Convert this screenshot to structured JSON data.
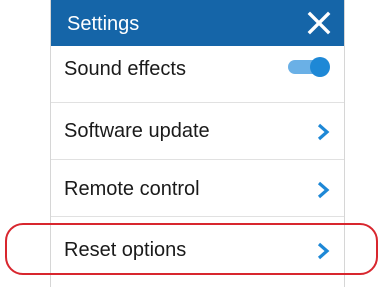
{
  "header": {
    "title": "Settings",
    "close_icon": "close-icon",
    "background_color": "#1565a8"
  },
  "settings": {
    "sound_effects": {
      "label": "Sound effects",
      "toggle_on": true,
      "accent_color": "#1e88d6"
    },
    "software_update": {
      "label": "Software update",
      "icon": "chevron-right-icon"
    },
    "remote_control": {
      "label": "Remote control",
      "icon": "chevron-right-icon"
    },
    "reset_options": {
      "label": "Reset options",
      "icon": "chevron-right-icon"
    }
  },
  "annotation": {
    "highlight_color": "#d8262e",
    "highlighted_item": "Reset options"
  }
}
